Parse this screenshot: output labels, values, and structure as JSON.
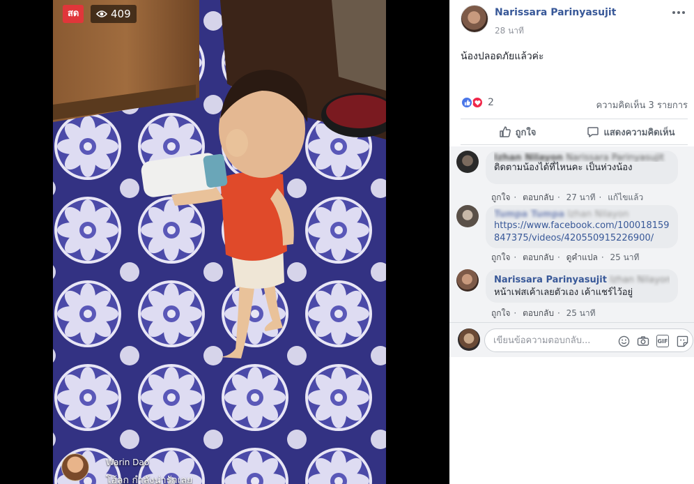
{
  "video": {
    "live_badge": "สด",
    "viewer_count": "409",
    "live_comment": {
      "name": "Warin Dao",
      "text": "โอ้ลูก กำลังน่ารักเลย"
    }
  },
  "post": {
    "author": "Narissara Parinyasujit",
    "timestamp": "28 นาที",
    "text": "น้องปลอดภัยแล้วค่ะ",
    "reaction_count": "2",
    "comment_count": "ความคิดเห็น 3 รายการ",
    "like_label": "ถูกใจ",
    "comment_label": "แสดงความคิดเห็น"
  },
  "comments": [
    {
      "name": "Izhan Nilayon",
      "mention": "Narissara Parinyasujit",
      "text": "ติดตามน้องได้ที่ไหนคะ เป็นห่วงน้อง",
      "actions": [
        "ถูกใจ",
        "ตอบกลับ",
        "27 นาที",
        "แก้ไขแล้ว"
      ]
    },
    {
      "name": "Tumpa Tumpa",
      "mention": "Izhan Nilayon",
      "link": "https://www.facebook.com/100018159847375/videos/420550915226900/",
      "link_line1": "https://www.facebook.com/100018159",
      "link_line2": "847375/videos/420550915226900/",
      "actions": [
        "ถูกใจ",
        "ตอบกลับ",
        "ดูคำแปล",
        "25 นาที"
      ]
    },
    {
      "name": "Narissara Parinyasujit",
      "mention": "Izhan Nilayon",
      "text": "หน้าเฟสเค้าเลยตัวเอง เค้าแชร์ไว้อยู่",
      "actions": [
        "ถูกใจ",
        "ตอบกลับ",
        "25 นาที"
      ]
    }
  ],
  "reply": {
    "placeholder": "เขียนข้อความตอบกลับ..."
  },
  "colors": {
    "accent": "#385898",
    "live_red": "#e0363a",
    "like_blue": "#4a76e8",
    "love_red": "#f0284a"
  },
  "icons": [
    "eye-icon",
    "more-icon",
    "like-reaction-icon",
    "love-reaction-icon",
    "thumbs-up-icon",
    "comment-bubble-icon",
    "emoji-icon",
    "camera-icon",
    "gif-icon",
    "sticker-icon"
  ]
}
